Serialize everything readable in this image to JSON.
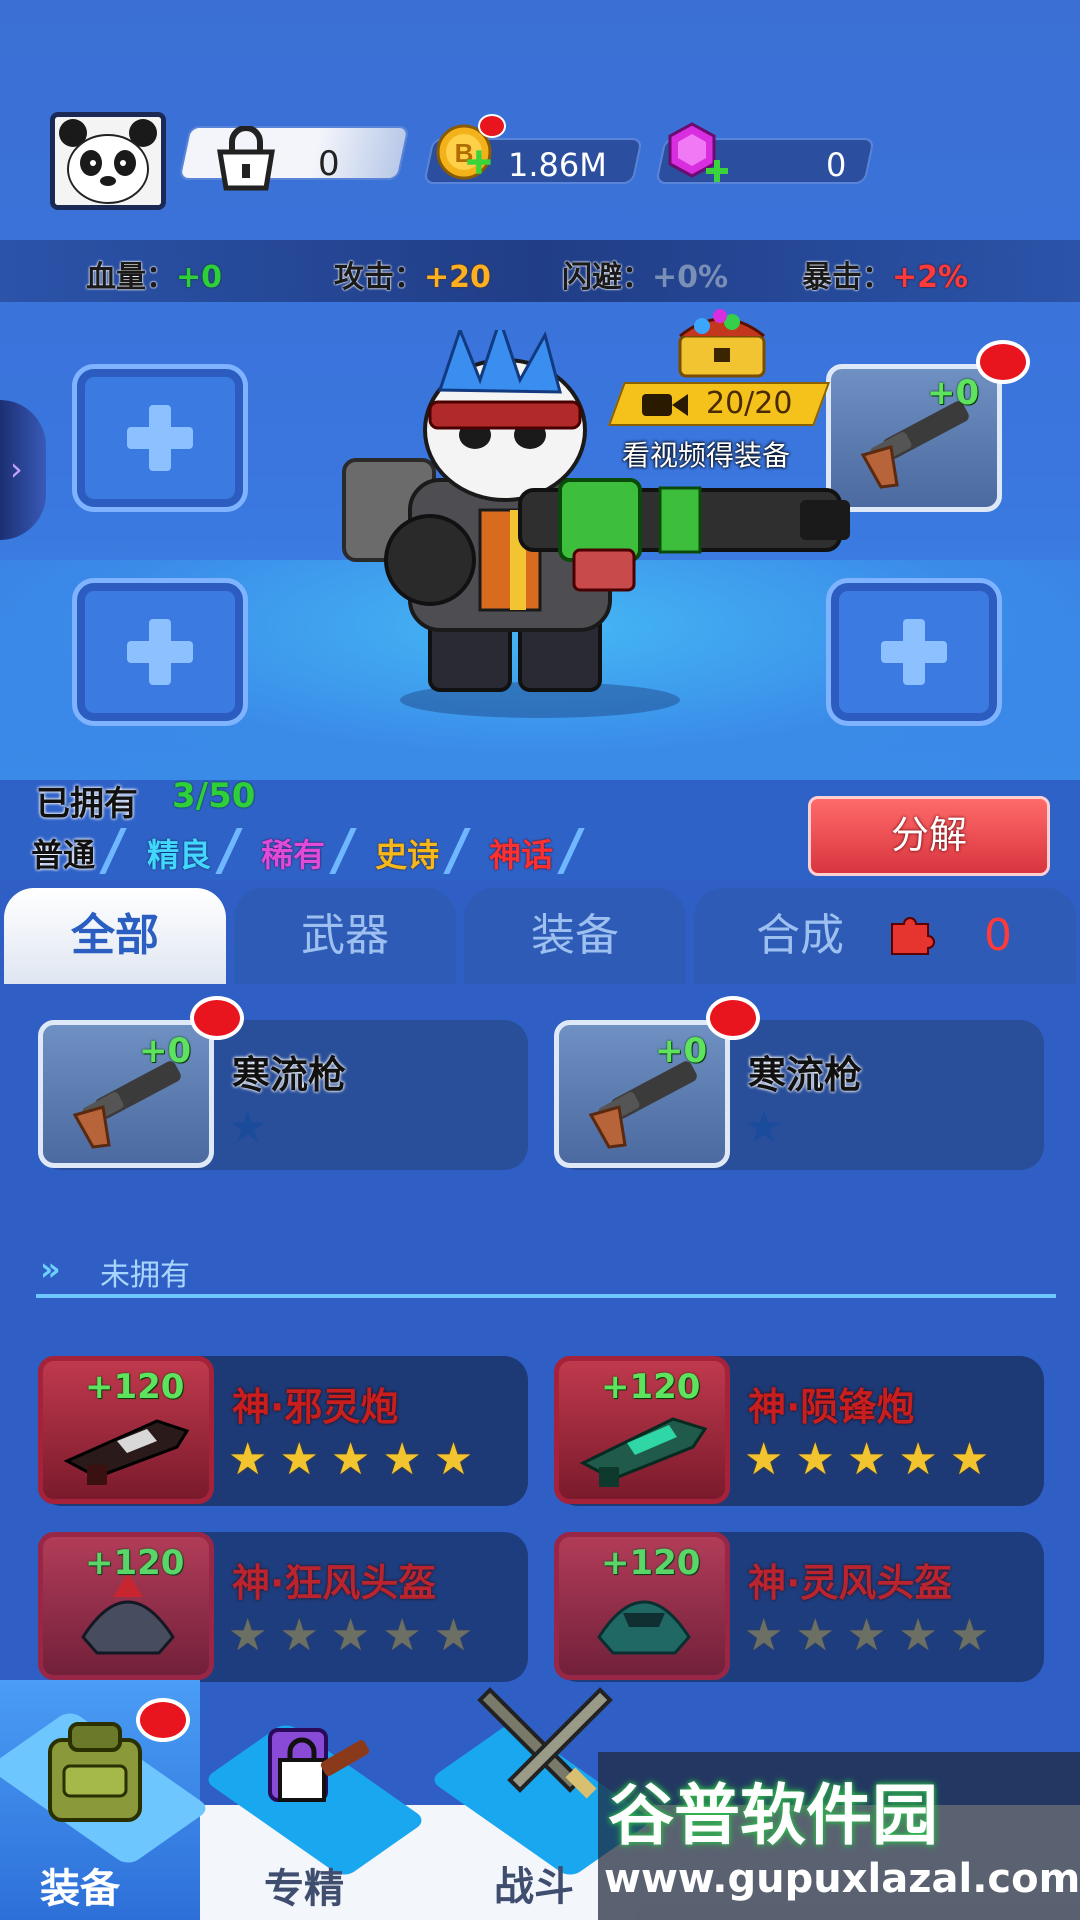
{
  "header": {
    "lock_count": "0",
    "coins": "1.86M",
    "gems": "0"
  },
  "stats": [
    {
      "label": "血量：",
      "value": "+0"
    },
    {
      "label": "攻击：",
      "value": "+20"
    },
    {
      "label": "闪避：",
      "value": "+0%"
    },
    {
      "label": "暴击：",
      "value": "+2%"
    }
  ],
  "video_reward": {
    "counter": "20/20",
    "caption": "看视频得装备"
  },
  "equipped_weapon": {
    "level": "+0"
  },
  "owned": {
    "label": "已拥有",
    "count": "3/50"
  },
  "rarities": [
    "普通",
    "精良",
    "稀有",
    "史诗",
    "神话"
  ],
  "decompose_label": "分解",
  "tabs": [
    "全部",
    "武器",
    "装备",
    "合成"
  ],
  "synth_count": "0",
  "owned_items": [
    {
      "level": "+0",
      "name": "寒流枪"
    },
    {
      "level": "+0",
      "name": "寒流枪"
    }
  ],
  "not_owned_label": "未拥有",
  "locked_items": [
    {
      "level": "+120",
      "name": "神·邪灵炮"
    },
    {
      "level": "+120",
      "name": "神·陨锋炮"
    },
    {
      "level": "+120",
      "name": "神·狂风头盔"
    },
    {
      "level": "+120",
      "name": "神·灵风头盔"
    }
  ],
  "bottom_nav": [
    "装备",
    "专精",
    "战斗"
  ],
  "watermark": {
    "main": "谷普软件园",
    "url": "www.gupuxlazal.com"
  },
  "colors": {
    "accent_red": "#e8141e",
    "gold": "#f2c530",
    "positive": "#2ed03a"
  }
}
